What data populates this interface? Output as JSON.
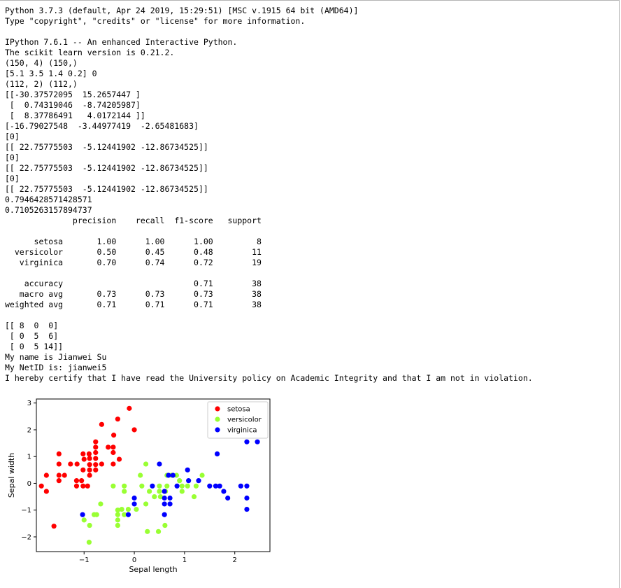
{
  "console": {
    "lines": [
      "Python 3.7.3 (default, Apr 24 2019, 15:29:51) [MSC v.1915 64 bit (AMD64)]",
      "Type \"copyright\", \"credits\" or \"license\" for more information.",
      "",
      "IPython 7.6.1 -- An enhanced Interactive Python.",
      "The scikit learn version is 0.21.2.",
      "(150, 4) (150,)",
      "[5.1 3.5 1.4 0.2] 0",
      "(112, 2) (112,)",
      "[[-30.37572095  15.2657447 ]",
      " [  0.74319046  -8.74205987]",
      " [  8.37786491   4.0172144 ]]",
      "[-16.79027548  -3.44977419  -2.65481683]",
      "[0]",
      "[[ 22.75775503  -5.12441902 -12.86734525]]",
      "[0]",
      "[[ 22.75775503  -5.12441902 -12.86734525]]",
      "[0]",
      "[[ 22.75775503  -5.12441902 -12.86734525]]",
      "0.7946428571428571",
      "0.7105263157894737",
      "              precision    recall  f1-score   support",
      "",
      "      setosa       1.00      1.00      1.00         8",
      "  versicolor       0.50      0.45      0.48        11",
      "   virginica       0.70      0.74      0.72        19",
      "",
      "    accuracy                           0.71        38",
      "   macro avg       0.73      0.73      0.73        38",
      "weighted avg       0.71      0.71      0.71        38",
      "",
      "[[ 8  0  0]",
      " [ 0  5  6]",
      " [ 0  5 14]]",
      "My name is Jianwei Su",
      "My NetID is: jianwei5",
      "I hereby certify that I have read the University policy on Academic Integrity and that I am not in violation."
    ]
  },
  "chart_data": {
    "type": "scatter",
    "xlabel": "Sepal length",
    "ylabel": "Sepal width",
    "xlim": [
      -1.95,
      2.7
    ],
    "ylim": [
      -2.55,
      3.15
    ],
    "xticks": [
      -1,
      0,
      1,
      2
    ],
    "xtick_labels": [
      "−1",
      "0",
      "1",
      "2"
    ],
    "yticks": [
      -2,
      -1,
      0,
      1,
      2,
      3
    ],
    "ytick_labels": [
      "−2",
      "−1",
      "0",
      "1",
      "2",
      "3"
    ],
    "grid": false,
    "legend_position": "top-right",
    "series": [
      {
        "name": "setosa",
        "color": "#ff0000",
        "points": [
          [
            -0.1,
            2.8
          ],
          [
            0,
            2.0
          ],
          [
            -0.33,
            2.4
          ],
          [
            -0.65,
            2.2
          ],
          [
            -0.41,
            1.8
          ],
          [
            -0.77,
            1.55
          ],
          [
            -0.77,
            1.35
          ],
          [
            -0.77,
            1.15
          ],
          [
            -0.52,
            1.35
          ],
          [
            -0.42,
            1.35
          ],
          [
            -0.42,
            1.15
          ],
          [
            -1.5,
            1.1
          ],
          [
            -1.02,
            1.1
          ],
          [
            -0.9,
            1.1
          ],
          [
            -0.89,
            0.93
          ],
          [
            -0.89,
            0.7
          ],
          [
            -0.89,
            0.5
          ],
          [
            -0.77,
            0.93
          ],
          [
            -0.77,
            0.7
          ],
          [
            -0.77,
            0.5
          ],
          [
            -1.0,
            0.9
          ],
          [
            -1.14,
            0.72
          ],
          [
            -1.5,
            0.72
          ],
          [
            -1.27,
            0.72
          ],
          [
            -0.65,
            0.72
          ],
          [
            -0.42,
            0.72
          ],
          [
            -0.3,
            0.9
          ],
          [
            -1.02,
            0.5
          ],
          [
            -1.75,
            0.3
          ],
          [
            -1.5,
            0.3
          ],
          [
            -1.39,
            0.3
          ],
          [
            -0.89,
            0.3
          ],
          [
            -1.5,
            0.1
          ],
          [
            -1.15,
            0.1
          ],
          [
            -1.05,
            0.1
          ],
          [
            -1.15,
            -0.1
          ],
          [
            -1.02,
            -0.1
          ],
          [
            -0.93,
            -0.1
          ],
          [
            -1.85,
            -0.1
          ],
          [
            -1.75,
            -0.3
          ],
          [
            -1.6,
            -1.6
          ]
        ]
      },
      {
        "name": "versicolor",
        "color": "#99ff33",
        "points": [
          [
            0.23,
            0.72
          ],
          [
            0.12,
            0.3
          ],
          [
            0.65,
            0.3
          ],
          [
            0.74,
            0.3
          ],
          [
            0.84,
            0.3
          ],
          [
            0.9,
            0.1
          ],
          [
            1.35,
            0.3
          ],
          [
            -0.42,
            -0.1
          ],
          [
            -0.2,
            -0.1
          ],
          [
            0.15,
            -0.1
          ],
          [
            0.5,
            -0.1
          ],
          [
            0.65,
            -0.1
          ],
          [
            0.95,
            -0.1
          ],
          [
            1.06,
            -0.1
          ],
          [
            1.23,
            -0.1
          ],
          [
            -0.2,
            -0.3
          ],
          [
            0.3,
            -0.3
          ],
          [
            0.5,
            -0.3
          ],
          [
            0.62,
            -0.3
          ],
          [
            0.95,
            -0.3
          ],
          [
            0.4,
            -0.5
          ],
          [
            0.52,
            -0.5
          ],
          [
            1.19,
            -0.5
          ],
          [
            -0.67,
            -0.77
          ],
          [
            0.23,
            -0.77
          ],
          [
            -0.12,
            -0.97
          ],
          [
            -0.25,
            -0.97
          ],
          [
            0.04,
            -0.97
          ],
          [
            -0.33,
            -1.17
          ],
          [
            -0.33,
            -1.0
          ],
          [
            -0.2,
            -1.17
          ],
          [
            -0.33,
            -1.37
          ],
          [
            -0.33,
            -1.57
          ],
          [
            -0.8,
            -1.17
          ],
          [
            -0.75,
            -1.17
          ],
          [
            -1.0,
            -1.37
          ],
          [
            -0.89,
            -1.57
          ],
          [
            0.61,
            -1.57
          ],
          [
            0.26,
            -1.8
          ],
          [
            0.48,
            -1.8
          ],
          [
            -0.9,
            -2.2
          ]
        ]
      },
      {
        "name": "virginica",
        "color": "#0000ff",
        "points": [
          [
            2.24,
            1.55
          ],
          [
            2.45,
            1.55
          ],
          [
            1.65,
            1.1
          ],
          [
            0.5,
            0.72
          ],
          [
            1.06,
            0.5
          ],
          [
            0.68,
            0.3
          ],
          [
            0.77,
            0.3
          ],
          [
            1.08,
            0.1
          ],
          [
            1.28,
            0.1
          ],
          [
            0.36,
            -0.1
          ],
          [
            0.85,
            -0.1
          ],
          [
            1.5,
            -0.1
          ],
          [
            1.62,
            -0.1
          ],
          [
            1.7,
            -0.1
          ],
          [
            2.12,
            -0.1
          ],
          [
            2.24,
            -0.1
          ],
          [
            0.6,
            -0.3
          ],
          [
            1.78,
            -0.3
          ],
          [
            0.0,
            -0.55
          ],
          [
            0.6,
            -0.55
          ],
          [
            0.71,
            -0.55
          ],
          [
            1.86,
            -0.55
          ],
          [
            2.24,
            -0.55
          ],
          [
            0.0,
            -0.77
          ],
          [
            0.6,
            -0.77
          ],
          [
            0.71,
            -0.77
          ],
          [
            2.24,
            -0.97
          ],
          [
            -1.03,
            -1.17
          ],
          [
            -0.12,
            -1.17
          ],
          [
            0.6,
            -1.17
          ]
        ]
      }
    ]
  }
}
